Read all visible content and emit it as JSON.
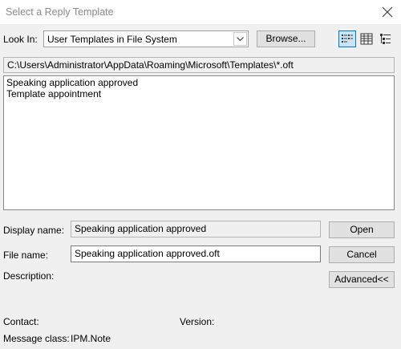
{
  "window": {
    "title": "Select a Reply Template"
  },
  "look_in": {
    "label": "Look In:",
    "value": "User Templates in File System",
    "browse_label": "Browse..."
  },
  "path": "C:\\Users\\Administrator\\AppData\\Roaming\\Microsoft\\Templates\\*.oft",
  "files": [
    {
      "name": "Speaking application approved"
    },
    {
      "name": "Template appointment"
    }
  ],
  "display_name": {
    "label": "Display name:",
    "value": "Speaking application approved"
  },
  "file_name": {
    "label": "File name:",
    "value": "Speaking application approved.oft"
  },
  "description": {
    "label": "Description:"
  },
  "buttons": {
    "open": "Open",
    "cancel": "Cancel",
    "advanced": "Advanced<<"
  },
  "contact": {
    "label": "Contact:"
  },
  "version": {
    "label": "Version:"
  },
  "message_class": {
    "label": "Message class:",
    "value": "IPM.Note"
  },
  "icons": {
    "close": "close-icon",
    "dropdown": "chevron-down-icon",
    "view_list": "list-view-icon",
    "view_details": "details-view-icon",
    "view_tree": "tree-view-icon"
  },
  "colors": {
    "selected_view_bg": "#cce4f7",
    "selected_view_border": "#0078d7",
    "title_text": "#8a8a8a"
  }
}
